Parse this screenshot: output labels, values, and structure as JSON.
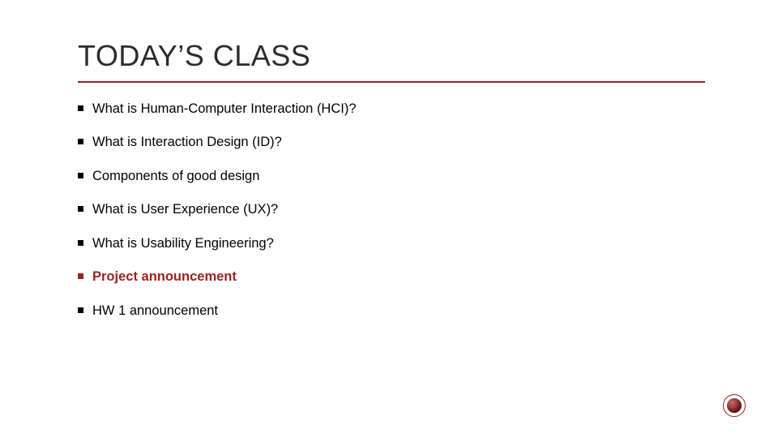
{
  "title": "TODAY’S CLASS",
  "accent_color": "#9c2222",
  "bullets": [
    {
      "text": "What is Human-Computer Interaction (HCI)?",
      "accent": false
    },
    {
      "text": "What is Interaction Design (ID)?",
      "accent": false
    },
    {
      "text": "Components of good design",
      "accent": false
    },
    {
      "text": "What is User Experience (UX)?",
      "accent": false
    },
    {
      "text": "What is Usability Engineering?",
      "accent": false
    },
    {
      "text": "Project announcement",
      "accent": true
    },
    {
      "text": "HW 1 announcement",
      "accent": false
    }
  ]
}
